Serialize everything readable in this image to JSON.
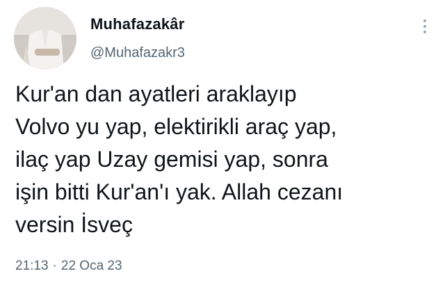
{
  "author": {
    "display_name": "Muhafazakâr",
    "handle": "@Muhafazakr3",
    "avatar_icon": "profile-photo"
  },
  "tweet": {
    "text": "Kur'an dan ayatleri araklayıp\nVolvo yu yap, elektirikli araç yap,\nilaç yap Uzay gemisi yap, sonra\nişin bitti Kur'an'ı yak. Allah cezanı\nversin İsveç",
    "time": "21:13",
    "separator": "·",
    "date": "22 Oca 23"
  },
  "menu": {
    "icon": "more-vertical-icon"
  },
  "colors": {
    "text": "#0f1419",
    "secondary": "#536471",
    "background": "#ffffff"
  }
}
